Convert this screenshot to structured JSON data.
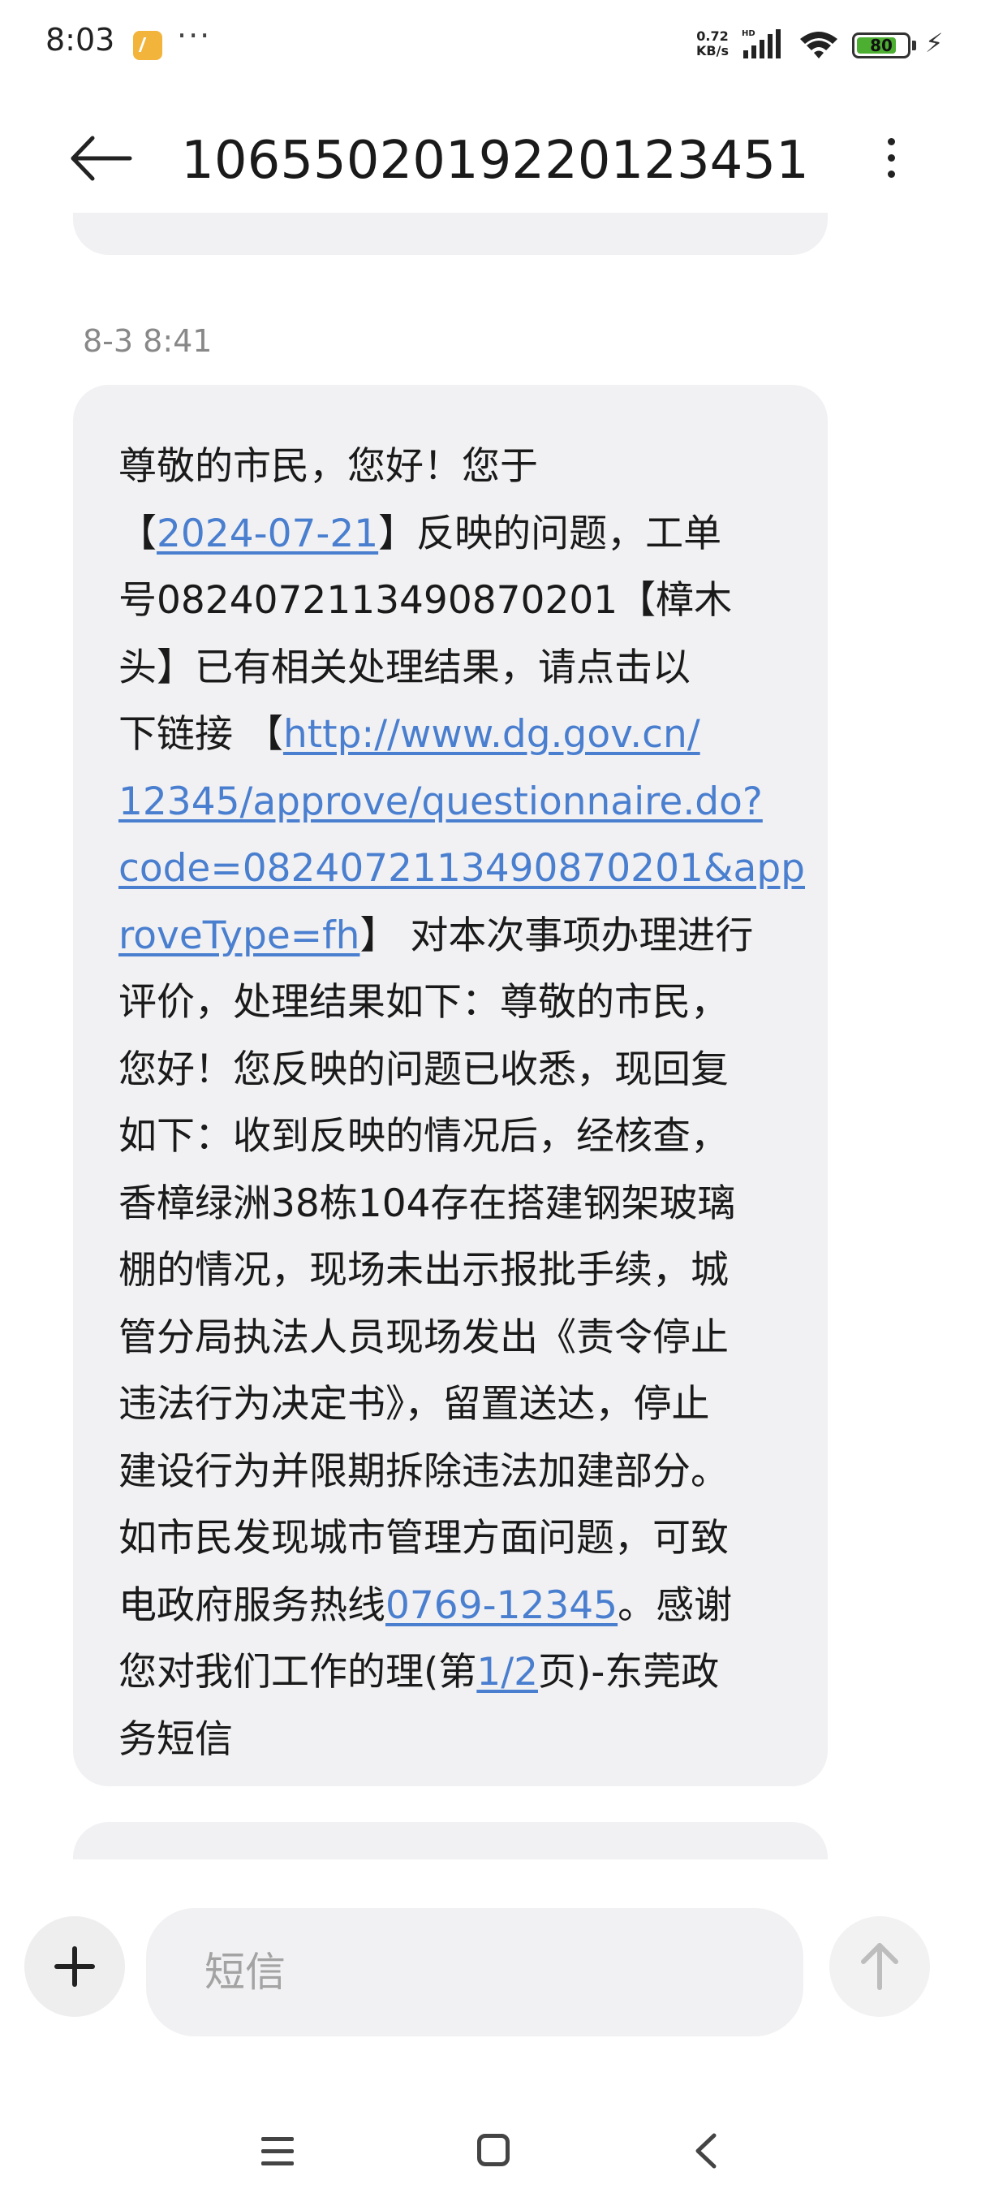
{
  "status_bar": {
    "time": "8:03",
    "more": "···",
    "net_speed_value": "0.72",
    "net_speed_unit": "KB/s",
    "network_badge": "HD",
    "battery": "80",
    "battery_level": 0.8,
    "icons": [
      "notes-notification-icon",
      "signal-icon",
      "wifi-icon",
      "battery-icon",
      "charging-bolt-icon"
    ]
  },
  "header": {
    "title": "10655020192201234 51"
  },
  "conversation": {
    "timestamp": "8-3 8:41",
    "message": {
      "lines": [
        [
          {
            "t": "尊敬的市民，您好！您于"
          }
        ],
        [
          {
            "t": "【"
          },
          {
            "t": "2024-07-21",
            "link": true
          },
          {
            "t": "】反映的问题，工单"
          }
        ],
        [
          {
            "t": "号0824072113490870201【樟木"
          }
        ],
        [
          {
            "t": "头】已有相关处理结果，请点击以"
          }
        ],
        [
          {
            "t": "下链接 【"
          },
          {
            "t": "http://www.dg.gov.cn/",
            "link": true
          }
        ],
        [
          {
            "t": "12345/approve/questionnaire.do?",
            "link": true
          }
        ],
        [
          {
            "t": "code=0824072113490870201&app",
            "link": true
          }
        ],
        [
          {
            "t": "roveType=fh",
            "link": true
          },
          {
            "t": "】 对本次事项办理进行"
          }
        ],
        [
          {
            "t": "评价，处理结果如下：尊敬的市民，"
          }
        ],
        [
          {
            "t": "您好！您反映的问题已收悉，现回复"
          }
        ],
        [
          {
            "t": "如下：收到反映的情况后，经核查，"
          }
        ],
        [
          {
            "t": "香樟绿洲38栋104存在搭建钢架玻璃"
          }
        ],
        [
          {
            "t": "棚的情况，现场未出示报批手续，城"
          }
        ],
        [
          {
            "t": "管分局执法人员现场发出《责令停止"
          }
        ],
        [
          {
            "t": "违法行为决定书》，留置送达，停止"
          }
        ],
        [
          {
            "t": "建设行为并限期拆除违法加建部分。"
          }
        ],
        [
          {
            "t": "如市民发现城市管理方面问题，可致"
          }
        ],
        [
          {
            "t": "电政府服务热线"
          },
          {
            "t": "0769-12345",
            "link": true
          },
          {
            "t": "。感谢"
          }
        ],
        [
          {
            "t": "您对我们工作的理(第"
          },
          {
            "t": "1/2",
            "link": true
          },
          {
            "t": "页)-东莞政"
          }
        ],
        [
          {
            "t": "务短信"
          }
        ]
      ]
    }
  },
  "composer": {
    "placeholder": "短信",
    "attach_icon": "plus-icon",
    "send_icon": "arrow-up-icon"
  },
  "nav_bar": {
    "icons": [
      "menu-icon",
      "home-icon",
      "back-icon"
    ]
  },
  "colors": {
    "link": "#4a7fd0",
    "bubble": "#f1f1f3",
    "battery": "#4caf32"
  }
}
